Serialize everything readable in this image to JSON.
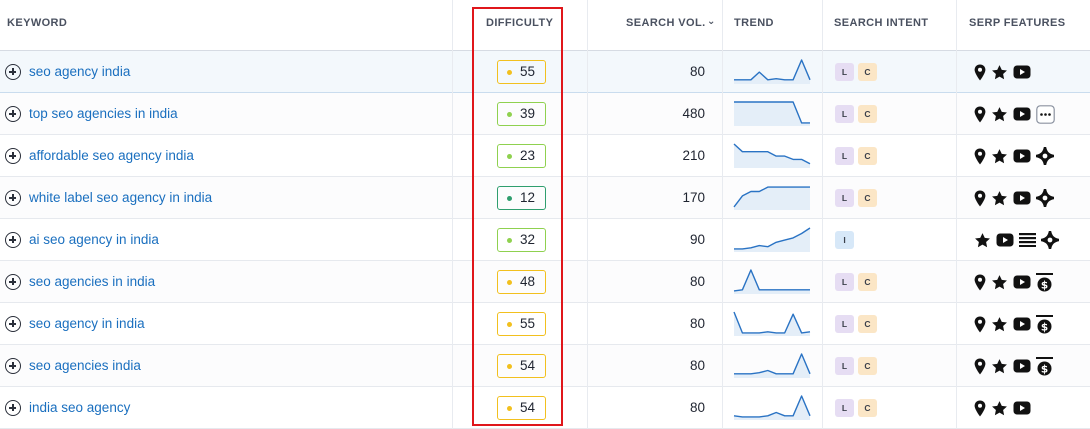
{
  "headers": {
    "keyword": "KEYWORD",
    "difficulty": "DIFFICULTY",
    "search_vol": "SEARCH VOL.",
    "trend": "TREND",
    "search_intent": "SEARCH INTENT",
    "serp_features": "SERP FEATURES"
  },
  "colors": {
    "yellow": "#f2c01e",
    "light_green": "#8fd14f",
    "green": "#2f9e6e",
    "link": "#1a6fbf",
    "highlight": "#e0161b"
  },
  "rows": [
    {
      "keyword": "seo agency india",
      "difficulty": "55",
      "level": "yellow",
      "volume": "80",
      "trend": [
        0.1,
        0.1,
        0.1,
        0.45,
        0.1,
        0.15,
        0.1,
        0.1,
        1,
        0.1
      ],
      "intent": [
        "L",
        "C"
      ],
      "serp": [
        "map-pin-icon",
        "star-icon",
        "video-icon"
      ]
    },
    {
      "keyword": "top seo agencies in india",
      "difficulty": "39",
      "level": "light_green",
      "volume": "480",
      "trend": [
        1,
        1,
        1,
        1,
        1,
        1,
        1,
        1,
        0.05,
        0.05
      ],
      "intent": [
        "L",
        "C"
      ],
      "serp": [
        "map-pin-icon",
        "star-icon",
        "video-icon",
        "more-icon"
      ]
    },
    {
      "keyword": "affordable seo agency india",
      "difficulty": "23",
      "level": "light_green",
      "volume": "210",
      "trend": [
        1,
        0.65,
        0.65,
        0.65,
        0.65,
        0.45,
        0.45,
        0.3,
        0.3,
        0.1
      ],
      "intent": [
        "L",
        "C"
      ],
      "serp": [
        "map-pin-icon",
        "star-icon",
        "video-icon",
        "sparkle-icon"
      ]
    },
    {
      "keyword": "white label seo agency in india",
      "difficulty": "12",
      "level": "green",
      "volume": "170",
      "trend": [
        0.05,
        0.55,
        0.75,
        0.75,
        0.95,
        0.95,
        0.95,
        0.95,
        0.95,
        0.95
      ],
      "intent": [
        "L",
        "C"
      ],
      "serp": [
        "map-pin-icon",
        "star-icon",
        "video-icon",
        "sparkle-icon"
      ]
    },
    {
      "keyword": "ai seo agency in india",
      "difficulty": "32",
      "level": "light_green",
      "volume": "90",
      "trend": [
        0.05,
        0.05,
        0.1,
        0.2,
        0.15,
        0.35,
        0.45,
        0.55,
        0.75,
        1
      ],
      "intent": [
        "I"
      ],
      "serp": [
        "star-icon",
        "video-icon",
        "list-icon",
        "sparkle-icon"
      ]
    },
    {
      "keyword": "seo agencies in india",
      "difficulty": "48",
      "level": "yellow",
      "volume": "80",
      "trend": [
        0.05,
        0.1,
        1,
        0.1,
        0.1,
        0.1,
        0.1,
        0.1,
        0.1,
        0.1
      ],
      "intent": [
        "L",
        "C"
      ],
      "serp": [
        "map-pin-icon",
        "star-icon",
        "video-icon",
        "dollar-badge-icon"
      ]
    },
    {
      "keyword": "seo agency in india",
      "difficulty": "55",
      "level": "yellow",
      "volume": "80",
      "trend": [
        1,
        0.05,
        0.05,
        0.05,
        0.1,
        0.05,
        0.05,
        0.9,
        0.05,
        0.1
      ],
      "intent": [
        "L",
        "C"
      ],
      "serp": [
        "map-pin-icon",
        "star-icon",
        "video-icon",
        "dollar-badge-icon"
      ]
    },
    {
      "keyword": "seo agencies india",
      "difficulty": "54",
      "level": "yellow",
      "volume": "80",
      "trend": [
        0.1,
        0.1,
        0.1,
        0.15,
        0.25,
        0.1,
        0.1,
        0.1,
        1,
        0.1
      ],
      "intent": [
        "L",
        "C"
      ],
      "serp": [
        "map-pin-icon",
        "star-icon",
        "video-icon",
        "dollar-badge-icon"
      ]
    },
    {
      "keyword": "india seo agency",
      "difficulty": "54",
      "level": "yellow",
      "volume": "80",
      "trend": [
        0.1,
        0.05,
        0.05,
        0.05,
        0.1,
        0.25,
        0.1,
        0.1,
        1,
        0.1
      ],
      "intent": [
        "L",
        "C"
      ],
      "serp": [
        "map-pin-icon",
        "star-icon",
        "video-icon"
      ]
    }
  ]
}
